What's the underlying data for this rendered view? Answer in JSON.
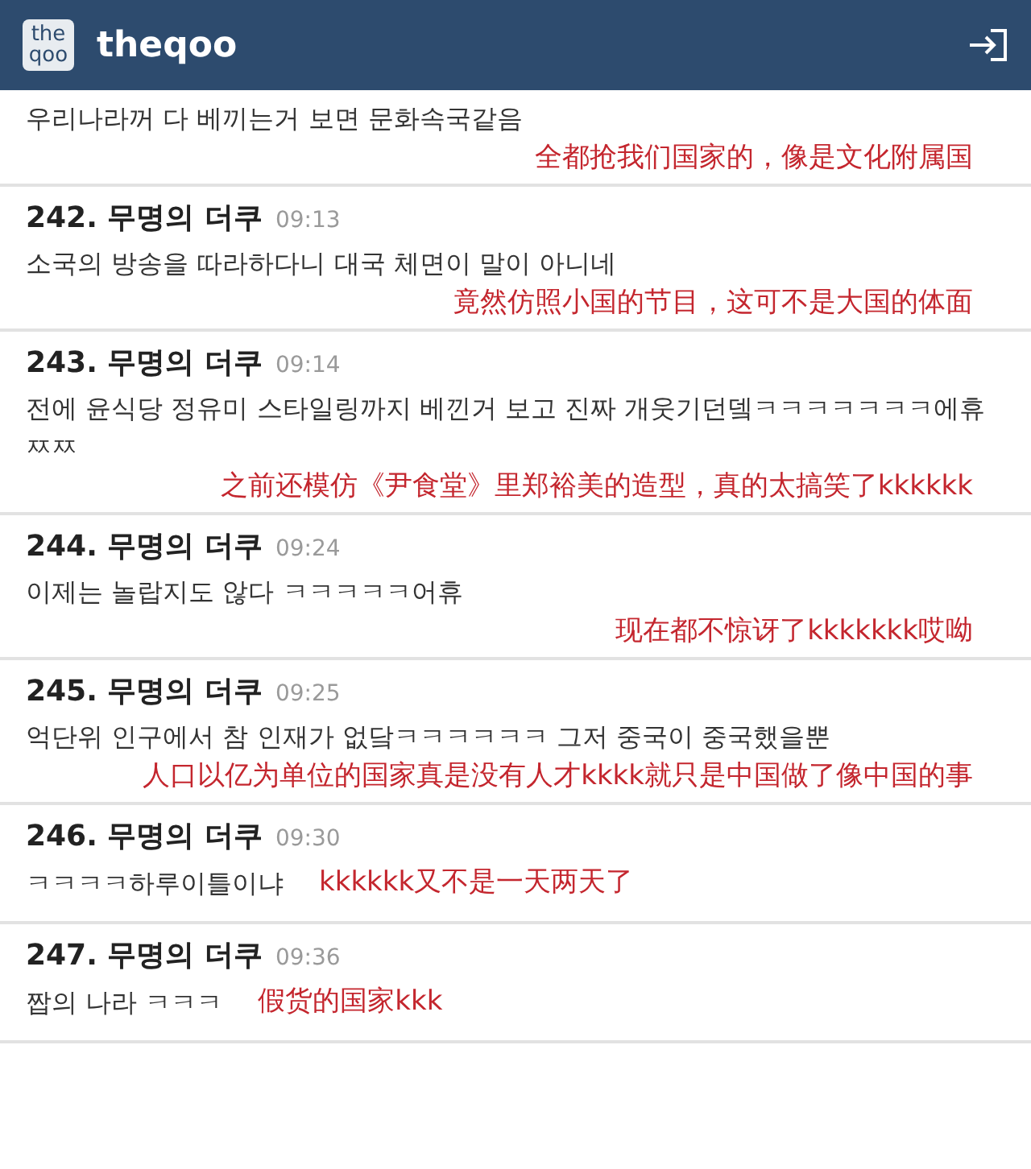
{
  "header": {
    "logo_lines": [
      "the",
      "qoo"
    ],
    "title": "theqoo"
  },
  "comments": [
    {
      "kind": "below",
      "body": "우리나라꺼 다 베끼는거 보면 문화속국같음",
      "translation": "全都抢我们国家的，像是文化附属国"
    },
    {
      "kind": "below",
      "number": "242.",
      "author": "무명의 더쿠",
      "time": "09:13",
      "body": "소국의 방송을 따라하다니 대국 체면이 말이 아니네",
      "translation": "竟然仿照小国的节目，这可不是大国的体面"
    },
    {
      "kind": "below",
      "number": "243.",
      "author": "무명의 더쿠",
      "time": "09:14",
      "body": "전에 윤식당 정유미 스타일링까지 베낀거 보고 진짜 개웃기던뎈ㅋㅋㅋㅋㅋㅋㅋ에휴 ㅉㅉ",
      "translation": "之前还模仿《尹食堂》里郑裕美的造型，真的太搞笑了kkkkkk"
    },
    {
      "kind": "below",
      "number": "244.",
      "author": "무명의 더쿠",
      "time": "09:24",
      "body": "이제는 놀랍지도 않다 ㅋㅋㅋㅋㅋ어휴",
      "translation": "现在都不惊讶了kkkkkkk哎呦"
    },
    {
      "kind": "below",
      "number": "245.",
      "author": "무명의 더쿠",
      "time": "09:25",
      "body": "억단위 인구에서 참 인재가 없닼ㅋㅋㅋㅋㅋㅋ 그저 중국이 중국했을뿐",
      "translation": "人口以亿为单位的国家真是没有人才kkkk就只是中国做了像中国的事"
    },
    {
      "kind": "inline",
      "number": "246.",
      "author": "무명의 더쿠",
      "time": "09:30",
      "body": "ㅋㅋㅋㅋ하루이틀이냐",
      "translation": "kkkkkk又不是一天两天了"
    },
    {
      "kind": "inline",
      "number": "247.",
      "author": "무명의 더쿠",
      "time": "09:36",
      "body": "짭의 나라 ㅋㅋㅋ",
      "translation": "假货的国家kkk"
    }
  ]
}
